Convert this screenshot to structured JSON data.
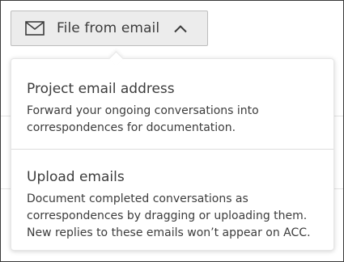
{
  "trigger": {
    "label": "File from email",
    "icon": "mail-icon",
    "chevron_icon": "chevron-up-icon",
    "expanded": true
  },
  "menu": {
    "items": [
      {
        "title": "Project email address",
        "description_lines": [
          "Forward your ongoing conversations into",
          "correspondences for documentation."
        ]
      },
      {
        "title": "Upload emails",
        "description_lines": [
          "Document completed conversations as",
          "correspondences by dragging or uploading them.",
          "New replies to these emails won’t appear on ACC."
        ]
      }
    ]
  },
  "colors": {
    "text": "#3c3c3c",
    "trigger_bg": "#ececec",
    "border": "#bdbdbd",
    "divider": "#dcdcdc"
  }
}
